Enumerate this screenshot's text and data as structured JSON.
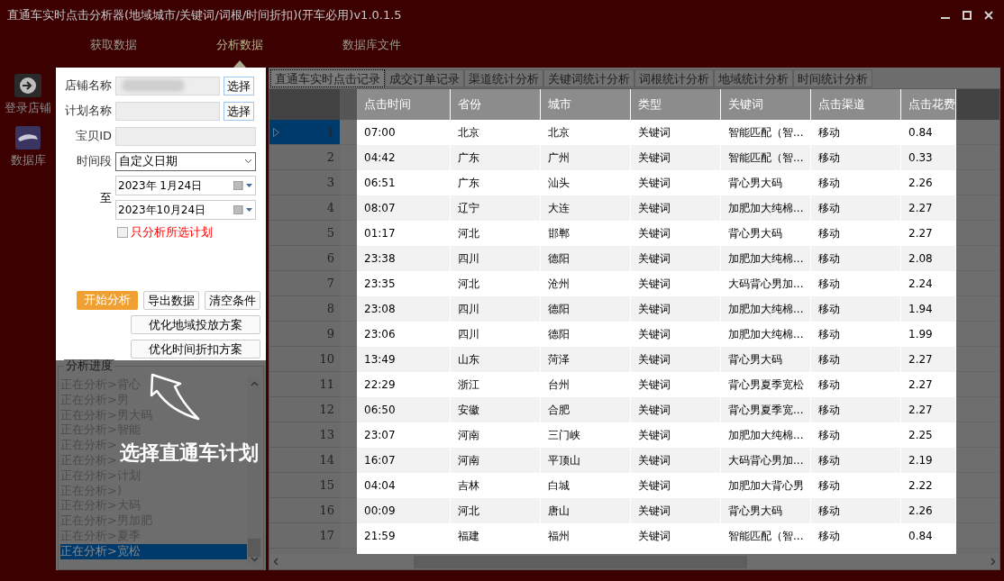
{
  "window": {
    "title": "直通车实时点击分析器(地域城市/关键词/词根/时间折扣)(开车必用)v1.0.1.5"
  },
  "menu_tabs": [
    {
      "label": "获取数据",
      "selected": false
    },
    {
      "label": "分析数据",
      "selected": true
    },
    {
      "label": "数据库文件",
      "selected": false
    }
  ],
  "sidebar": {
    "items": [
      {
        "kind": "login",
        "label": "登录店铺"
      },
      {
        "kind": "database",
        "label": "数据库"
      }
    ]
  },
  "query_panel": {
    "shop_name": {
      "label": "店铺名称",
      "button": "选择"
    },
    "plan_name": {
      "label": "计划名称",
      "button": "选择"
    },
    "item_id": {
      "label": "宝贝ID"
    },
    "period": {
      "label": "时间段",
      "value": "自定义日期"
    },
    "range": {
      "label": "至",
      "start": "2023年 1月24日",
      "end": "2023年10月24日"
    },
    "only_selected": {
      "label": "只分析所选计划",
      "checked": false
    },
    "buttons": [
      {
        "kind": "primary",
        "label": "开始分析"
      },
      {
        "kind": "normal",
        "label": "导出数据"
      },
      {
        "kind": "normal",
        "label": "清空条件"
      }
    ],
    "wide_buttons": [
      "优化地域投放方案",
      "优化时间折扣方案"
    ]
  },
  "progress": {
    "title": "分析进度",
    "items": [
      {
        "text": "正在分析>背心",
        "selected": false
      },
      {
        "text": "正在分析>男",
        "selected": false
      },
      {
        "text": "正在分析>男大码",
        "selected": false
      },
      {
        "text": "正在分析>智能",
        "selected": false
      },
      {
        "text": "正在分析>",
        "selected": false
      },
      {
        "text": "正在分析>",
        "selected": false
      },
      {
        "text": "正在分析>计划",
        "selected": false
      },
      {
        "text": "正在分析>)",
        "selected": false
      },
      {
        "text": "正在分析>大码",
        "selected": false
      },
      {
        "text": "正在分析>男加肥",
        "selected": false
      },
      {
        "text": "正在分析>夏季",
        "selected": false
      },
      {
        "text": "正在分析>宽松",
        "selected": true
      }
    ]
  },
  "data_tabs": [
    {
      "label": "直通车实时点击记录",
      "selected": true
    },
    {
      "label": "成交订单记录",
      "selected": false
    },
    {
      "label": "渠道统计分析",
      "selected": false
    },
    {
      "label": "关键词统计分析",
      "selected": false
    },
    {
      "label": "词根统计分析",
      "selected": false
    },
    {
      "label": "地域统计分析",
      "selected": false
    },
    {
      "label": "时间统计分析",
      "selected": false
    }
  ],
  "table": {
    "columns": [
      "点击时间",
      "省份",
      "城市",
      "类型",
      "关键词",
      "点击渠道",
      "点击花费"
    ],
    "rows": [
      {
        "number": "1",
        "selected": true,
        "cells": [
          "07:00",
          "北京",
          "北京",
          "关键词",
          "智能匹配（智...",
          "移动",
          "0.84"
        ]
      },
      {
        "number": "2",
        "selected": false,
        "cells": [
          "04:42",
          "广东",
          "广州",
          "关键词",
          "智能匹配（智...",
          "移动",
          "0.33"
        ]
      },
      {
        "number": "3",
        "selected": false,
        "cells": [
          "06:51",
          "广东",
          "汕头",
          "关键词",
          "背心男大码",
          "移动",
          "2.26"
        ]
      },
      {
        "number": "4",
        "selected": false,
        "cells": [
          "08:07",
          "辽宁",
          "大连",
          "关键词",
          "加肥加大纯棉...",
          "移动",
          "2.27"
        ]
      },
      {
        "number": "5",
        "selected": false,
        "cells": [
          "01:17",
          "河北",
          "邯郸",
          "关键词",
          "背心男大码",
          "移动",
          "2.27"
        ]
      },
      {
        "number": "6",
        "selected": false,
        "cells": [
          "23:38",
          "四川",
          "德阳",
          "关键词",
          "加肥加大纯棉...",
          "移动",
          "2.08"
        ]
      },
      {
        "number": "7",
        "selected": false,
        "cells": [
          "23:35",
          "河北",
          "沧州",
          "关键词",
          "大码背心男加...",
          "移动",
          "2.24"
        ]
      },
      {
        "number": "8",
        "selected": false,
        "cells": [
          "23:08",
          "四川",
          "德阳",
          "关键词",
          "加肥加大纯棉...",
          "移动",
          "1.94"
        ]
      },
      {
        "number": "9",
        "selected": false,
        "cells": [
          "23:06",
          "四川",
          "德阳",
          "关键词",
          "加肥加大纯棉...",
          "移动",
          "1.99"
        ]
      },
      {
        "number": "10",
        "selected": false,
        "cells": [
          "13:49",
          "山东",
          "菏泽",
          "关键词",
          "背心男大码",
          "移动",
          "2.27"
        ]
      },
      {
        "number": "11",
        "selected": false,
        "cells": [
          "22:29",
          "浙江",
          "台州",
          "关键词",
          "背心男夏季宽松",
          "移动",
          "2.27"
        ]
      },
      {
        "number": "12",
        "selected": false,
        "cells": [
          "06:50",
          "安徽",
          "合肥",
          "关键词",
          "背心男夏季宽...",
          "移动",
          "2.27"
        ]
      },
      {
        "number": "13",
        "selected": false,
        "cells": [
          "23:07",
          "河南",
          "三门峡",
          "关键词",
          "加肥加大纯棉...",
          "移动",
          "2.25"
        ]
      },
      {
        "number": "14",
        "selected": false,
        "cells": [
          "16:07",
          "河南",
          "平顶山",
          "关键词",
          "大码背心男加...",
          "移动",
          "2.19"
        ]
      },
      {
        "number": "15",
        "selected": false,
        "cells": [
          "04:04",
          "吉林",
          "白城",
          "关键词",
          "加肥加大背心男",
          "移动",
          "2.22"
        ]
      },
      {
        "number": "16",
        "selected": false,
        "cells": [
          "00:09",
          "河北",
          "唐山",
          "关键词",
          "背心男大码",
          "移动",
          "2.26"
        ]
      },
      {
        "number": "17",
        "selected": false,
        "cells": [
          "21:59",
          "福建",
          "福州",
          "关键词",
          "智能匹配（智...",
          "移动",
          "0.84"
        ]
      }
    ]
  },
  "annotation": {
    "text": "选择直通车计划"
  }
}
